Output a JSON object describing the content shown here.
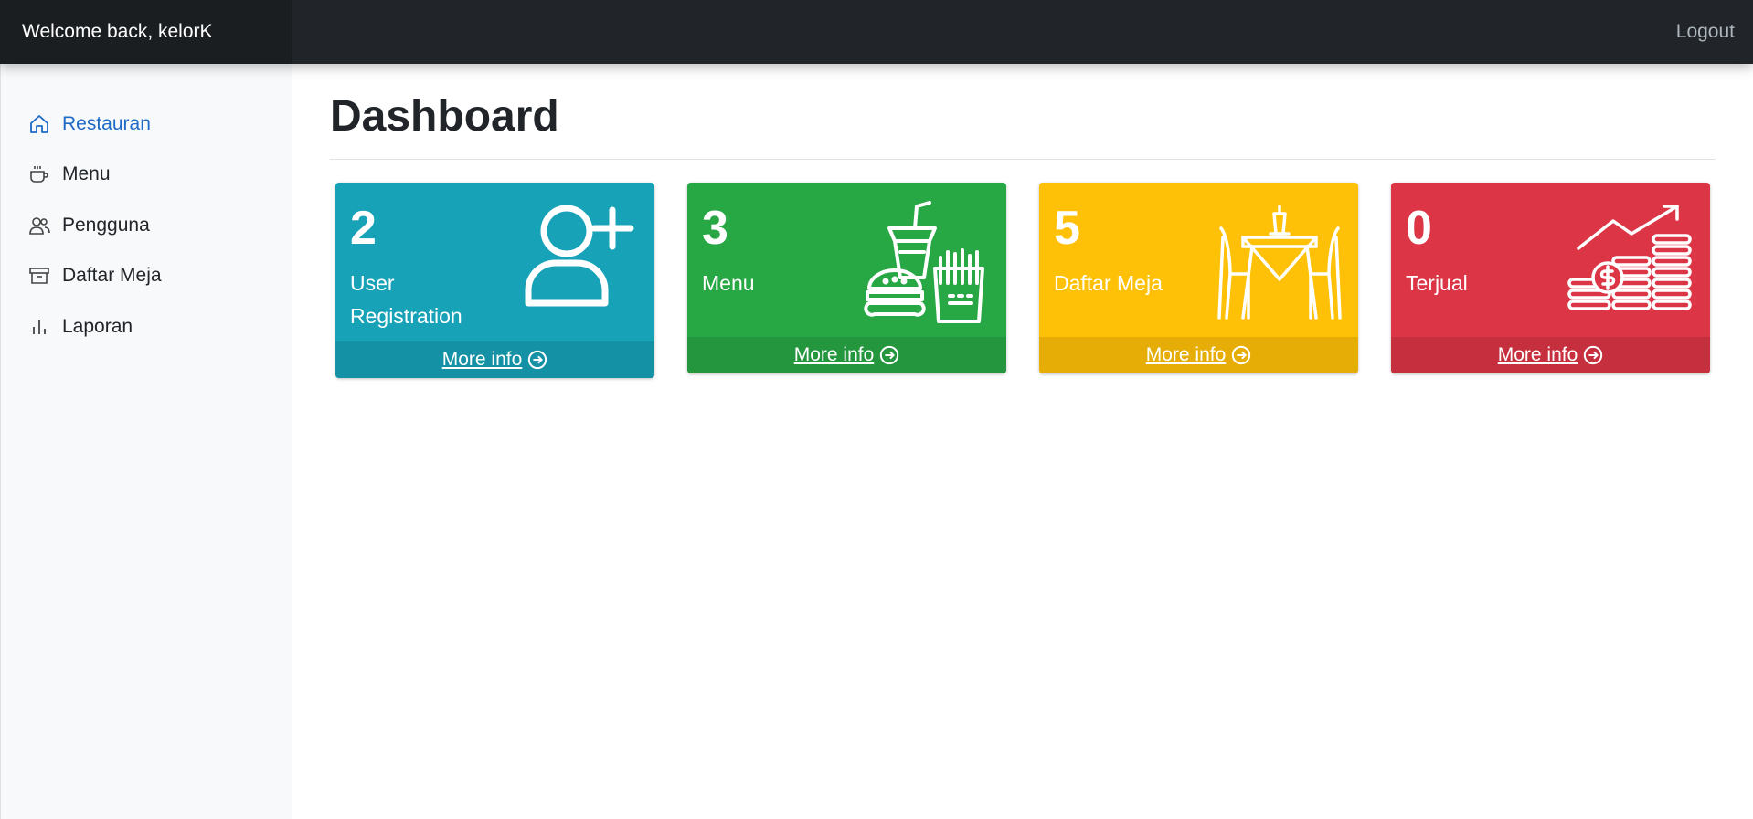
{
  "header": {
    "welcome": "Welcome back, kelorK",
    "logout": "Logout"
  },
  "sidebar": {
    "items": [
      {
        "label": "Restauran",
        "icon": "home-icon",
        "active": true
      },
      {
        "label": "Menu",
        "icon": "cup-icon",
        "active": false
      },
      {
        "label": "Pengguna",
        "icon": "people-icon",
        "active": false
      },
      {
        "label": "Daftar Meja",
        "icon": "archive-icon",
        "active": false
      },
      {
        "label": "Laporan",
        "icon": "bar-chart-icon",
        "active": false
      }
    ]
  },
  "main": {
    "title": "Dashboard",
    "cards": [
      {
        "count": "2",
        "label": "User Registration",
        "footer": "More info",
        "color": "#17a2b8",
        "icon": "user-plus-icon"
      },
      {
        "count": "3",
        "label": "Menu",
        "footer": "More info",
        "color": "#28a745",
        "icon": "fast-food-icon"
      },
      {
        "count": "5",
        "label": "Daftar Meja",
        "footer": "More info",
        "color": "#ffc107",
        "icon": "dining-table-icon"
      },
      {
        "count": "0",
        "label": "Terjual",
        "footer": "More info",
        "color": "#dc3545",
        "icon": "coins-growth-icon"
      }
    ]
  },
  "colors": {
    "topbar": "#212529",
    "active_link": "#1e6ac7",
    "sidebar_bg": "#f8f9fa"
  }
}
